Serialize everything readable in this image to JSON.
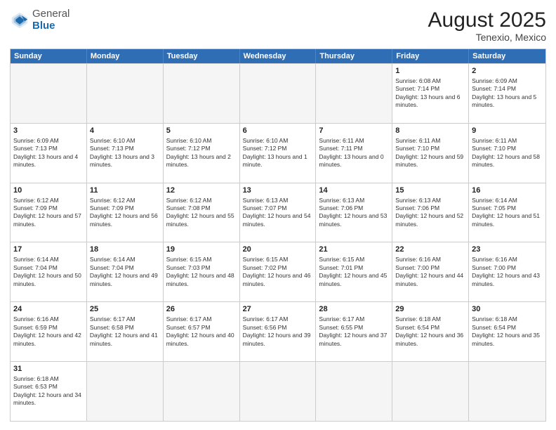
{
  "header": {
    "logo_general": "General",
    "logo_blue": "Blue",
    "title": "August 2025",
    "subtitle": "Tenexio, Mexico"
  },
  "days_of_week": [
    "Sunday",
    "Monday",
    "Tuesday",
    "Wednesday",
    "Thursday",
    "Friday",
    "Saturday"
  ],
  "rows": [
    [
      {
        "day": "",
        "empty": true
      },
      {
        "day": "",
        "empty": true
      },
      {
        "day": "",
        "empty": true
      },
      {
        "day": "",
        "empty": true
      },
      {
        "day": "",
        "empty": true
      },
      {
        "day": "1",
        "sunrise": "6:08 AM",
        "sunset": "7:14 PM",
        "daylight": "13 hours and 6 minutes."
      },
      {
        "day": "2",
        "sunrise": "6:09 AM",
        "sunset": "7:14 PM",
        "daylight": "13 hours and 5 minutes."
      }
    ],
    [
      {
        "day": "3",
        "sunrise": "6:09 AM",
        "sunset": "7:13 PM",
        "daylight": "13 hours and 4 minutes."
      },
      {
        "day": "4",
        "sunrise": "6:10 AM",
        "sunset": "7:13 PM",
        "daylight": "13 hours and 3 minutes."
      },
      {
        "day": "5",
        "sunrise": "6:10 AM",
        "sunset": "7:12 PM",
        "daylight": "13 hours and 2 minutes."
      },
      {
        "day": "6",
        "sunrise": "6:10 AM",
        "sunset": "7:12 PM",
        "daylight": "13 hours and 1 minute."
      },
      {
        "day": "7",
        "sunrise": "6:11 AM",
        "sunset": "7:11 PM",
        "daylight": "13 hours and 0 minutes."
      },
      {
        "day": "8",
        "sunrise": "6:11 AM",
        "sunset": "7:10 PM",
        "daylight": "12 hours and 59 minutes."
      },
      {
        "day": "9",
        "sunrise": "6:11 AM",
        "sunset": "7:10 PM",
        "daylight": "12 hours and 58 minutes."
      }
    ],
    [
      {
        "day": "10",
        "sunrise": "6:12 AM",
        "sunset": "7:09 PM",
        "daylight": "12 hours and 57 minutes."
      },
      {
        "day": "11",
        "sunrise": "6:12 AM",
        "sunset": "7:09 PM",
        "daylight": "12 hours and 56 minutes."
      },
      {
        "day": "12",
        "sunrise": "6:12 AM",
        "sunset": "7:08 PM",
        "daylight": "12 hours and 55 minutes."
      },
      {
        "day": "13",
        "sunrise": "6:13 AM",
        "sunset": "7:07 PM",
        "daylight": "12 hours and 54 minutes."
      },
      {
        "day": "14",
        "sunrise": "6:13 AM",
        "sunset": "7:06 PM",
        "daylight": "12 hours and 53 minutes."
      },
      {
        "day": "15",
        "sunrise": "6:13 AM",
        "sunset": "7:06 PM",
        "daylight": "12 hours and 52 minutes."
      },
      {
        "day": "16",
        "sunrise": "6:14 AM",
        "sunset": "7:05 PM",
        "daylight": "12 hours and 51 minutes."
      }
    ],
    [
      {
        "day": "17",
        "sunrise": "6:14 AM",
        "sunset": "7:04 PM",
        "daylight": "12 hours and 50 minutes."
      },
      {
        "day": "18",
        "sunrise": "6:14 AM",
        "sunset": "7:04 PM",
        "daylight": "12 hours and 49 minutes."
      },
      {
        "day": "19",
        "sunrise": "6:15 AM",
        "sunset": "7:03 PM",
        "daylight": "12 hours and 48 minutes."
      },
      {
        "day": "20",
        "sunrise": "6:15 AM",
        "sunset": "7:02 PM",
        "daylight": "12 hours and 46 minutes."
      },
      {
        "day": "21",
        "sunrise": "6:15 AM",
        "sunset": "7:01 PM",
        "daylight": "12 hours and 45 minutes."
      },
      {
        "day": "22",
        "sunrise": "6:16 AM",
        "sunset": "7:00 PM",
        "daylight": "12 hours and 44 minutes."
      },
      {
        "day": "23",
        "sunrise": "6:16 AM",
        "sunset": "7:00 PM",
        "daylight": "12 hours and 43 minutes."
      }
    ],
    [
      {
        "day": "24",
        "sunrise": "6:16 AM",
        "sunset": "6:59 PM",
        "daylight": "12 hours and 42 minutes."
      },
      {
        "day": "25",
        "sunrise": "6:17 AM",
        "sunset": "6:58 PM",
        "daylight": "12 hours and 41 minutes."
      },
      {
        "day": "26",
        "sunrise": "6:17 AM",
        "sunset": "6:57 PM",
        "daylight": "12 hours and 40 minutes."
      },
      {
        "day": "27",
        "sunrise": "6:17 AM",
        "sunset": "6:56 PM",
        "daylight": "12 hours and 39 minutes."
      },
      {
        "day": "28",
        "sunrise": "6:17 AM",
        "sunset": "6:55 PM",
        "daylight": "12 hours and 37 minutes."
      },
      {
        "day": "29",
        "sunrise": "6:18 AM",
        "sunset": "6:54 PM",
        "daylight": "12 hours and 36 minutes."
      },
      {
        "day": "30",
        "sunrise": "6:18 AM",
        "sunset": "6:54 PM",
        "daylight": "12 hours and 35 minutes."
      }
    ],
    [
      {
        "day": "31",
        "sunrise": "6:18 AM",
        "sunset": "6:53 PM",
        "daylight": "12 hours and 34 minutes."
      },
      {
        "day": "",
        "empty": true
      },
      {
        "day": "",
        "empty": true
      },
      {
        "day": "",
        "empty": true
      },
      {
        "day": "",
        "empty": true
      },
      {
        "day": "",
        "empty": true
      },
      {
        "day": "",
        "empty": true
      }
    ]
  ]
}
